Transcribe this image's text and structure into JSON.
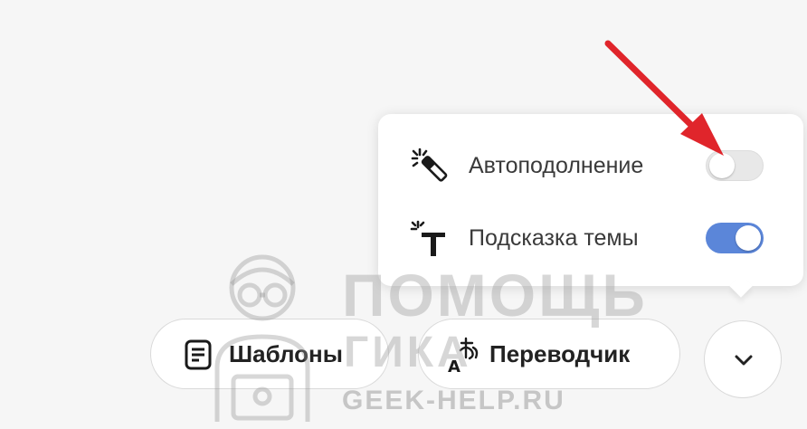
{
  "popup": {
    "items": [
      {
        "label": "Автоподолнение",
        "toggle_on": false,
        "icon": "magic-wand-icon"
      },
      {
        "label": "Подсказка темы",
        "toggle_on": true,
        "icon": "sparkle-text-icon"
      }
    ]
  },
  "toolbar": {
    "templates": {
      "label": "Шаблоны",
      "icon": "document-icon"
    },
    "translator": {
      "label": "Переводчик",
      "icon": "translate-icon"
    },
    "more": {
      "icon": "chevron-down-icon"
    }
  },
  "watermark": {
    "line1": "ПОМОЩЬ",
    "line2": "ГИКА",
    "url": "GEEK-HELP.RU"
  },
  "colors": {
    "toggle_on": "#5b86d9",
    "toggle_off": "#e8e8e8",
    "arrow": "#e0252b"
  }
}
